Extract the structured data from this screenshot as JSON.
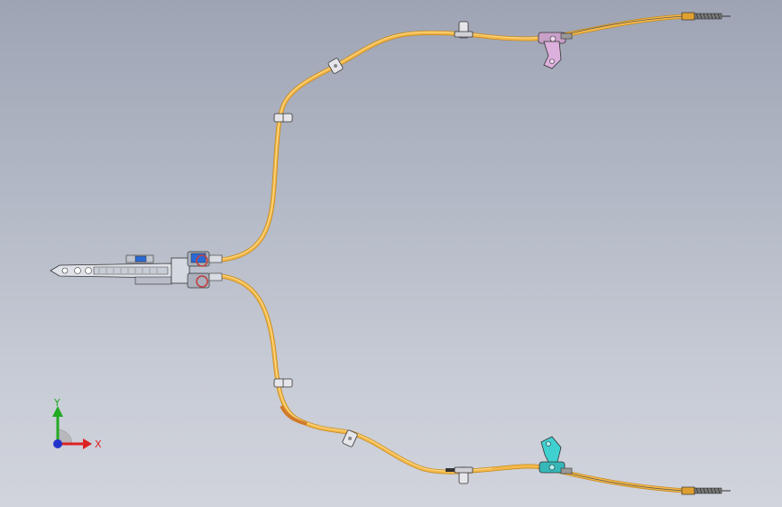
{
  "viewport": {
    "background_top": "#9ea4b4",
    "background_bottom": "#d1d4dc"
  },
  "model": {
    "cable_color": "#f2b84a",
    "cable_highlight": "#ffd27a",
    "cable_shadow": "#c88a1e",
    "clip_color": "#d8d8dc",
    "upper_bracket_color": "#d8a8d8",
    "lower_bracket_color": "#3fd0d0",
    "lever_color": "#c8ccd4",
    "lever_accent": "#2a6ad8",
    "lever_red": "#c04040"
  },
  "triad": {
    "y_label": "Y",
    "x_label": "X",
    "y_color": "#22aa22",
    "x_color": "#dd2222",
    "z_color": "#2233cc"
  }
}
